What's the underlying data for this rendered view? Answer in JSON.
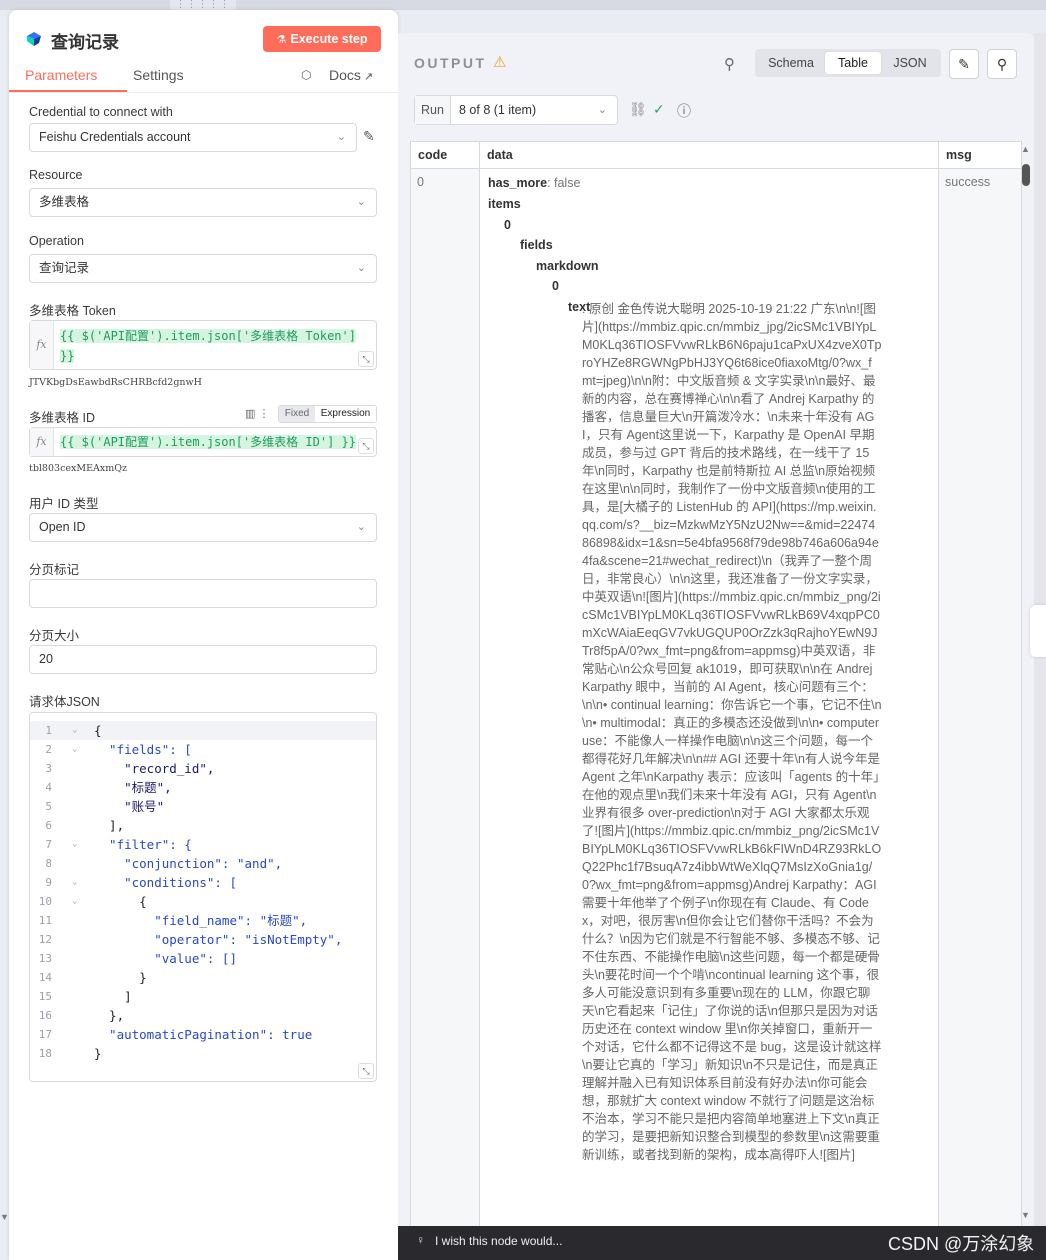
{
  "node": {
    "title": "查询记录",
    "execute_label": "Execute step",
    "tabs": [
      "Parameters",
      "Settings"
    ],
    "docs_label": "Docs"
  },
  "params": {
    "credential": {
      "label": "Credential to connect with",
      "value": "Feishu Credentials account"
    },
    "resource": {
      "label": "Resource",
      "value": "多维表格"
    },
    "operation": {
      "label": "Operation",
      "value": "查询记录"
    },
    "token": {
      "label": "多维表格 Token",
      "expression": "{{ $('API配置').item.json['多维表格 Token'] }}",
      "result": "JTVKbgDsEawbdRsCHRBcfd2gnwH"
    },
    "table_id": {
      "label": "多维表格 ID",
      "toggle_fixed": "Fixed",
      "toggle_expression": "Expression",
      "expression": "{{ $('API配置').item.json['多维表格 ID'] }}",
      "result": "tbl803cexMEAxmQz"
    },
    "user_id_type": {
      "label": "用户 ID 类型",
      "value": "Open ID"
    },
    "page_token": {
      "label": "分页标记",
      "value": ""
    },
    "page_size": {
      "label": "分页大小",
      "value": "20"
    },
    "body_json": {
      "label": "请求体JSON",
      "lines": [
        "{",
        "  \"fields\": [",
        "    \"record_id\",",
        "    \"标题\",",
        "    \"账号\"",
        "  ],",
        "  \"filter\": {",
        "    \"conjunction\": \"and\",",
        "    \"conditions\": [",
        "      {",
        "        \"field_name\": \"标题\",",
        "        \"operator\": \"isNotEmpty\",",
        "        \"value\": []",
        "      }",
        "    ]",
        "  },",
        "  \"automaticPagination\": true",
        "}"
      ]
    }
  },
  "output": {
    "title": "OUTPUT",
    "views": [
      "Schema",
      "Table",
      "JSON"
    ],
    "active_view": "Table",
    "run_label": "Run",
    "run_value": "8 of 8 (1 item)",
    "columns": [
      "code",
      "data",
      "msg"
    ],
    "row": {
      "code": "0",
      "msg": "success",
      "has_more_key": "has_more",
      "has_more_value": ": false",
      "items_key": "items",
      "index0": "0",
      "fields_key": "fields",
      "markdown_key": "markdown",
      "index0b": "0",
      "text_key": "text",
      "text_value": ": 原创 金色传说大聪明 2025-10-19 21:22 广东\\n\\n![图片](https://mmbiz.qpic.cn/mmbiz_jpg/2icSMc1VBIYpLM0KLq36TIOSFVvwRLkB6N6paju1caPxUX4zveX0TproYHZe8RGWNgPbHJ3YQ6t68ice0fiaxoMtg/0?wx_fmt=jpeg)\\n\\n附：中文版音频 & 文字实录\\n\\n最好、最新的内容，总在赛博禅心\\n\\n看了 Andrej Karpathy 的播客，信息量巨大\\n开篇泼冷水：\\n未来十年没有 AGI，只有 Agent这里说一下，Karpathy 是 OpenAI 早期成员，参与过 GPT 背后的技术路线，在一线干了 15 年\\n同时，Karpathy 也是前特斯拉 AI 总监\\n原始视频在这里\\n\\n同时，我制作了一份中文版音频\\n使用的工具，是[大橘子的 ListenHub 的 API](https://mp.weixin.qq.com/s?__biz=MzkwMzY5NzU2Nw==&mid=2247486898&idx=1&sn=5e4bfa9568f79de98b746a606a94e4fa&scene=21#wechat_redirect)\\n（我弄了一整个周日，非常良心）\\n\\n这里，我还准备了一份文字实录，中英双语\\n![图片](https://mmbiz.qpic.cn/mmbiz_png/2icSMc1VBIYpLM0KLq36TIOSFVvwRLkB69V4xqpPC0mXcWAiaEeqGV7vkUGQUP0OrZzk3qRajhoYEwN9JTr8f5pA/0?wx_fmt=png&from=appmsg)中英双语，非常贴心\\n公众号回复 ak1019，即可获取\\n\\n在 Andrej Karpathy 眼中，当前的 AI Agent，核心问题有三个：\\n\\n• continual learning：你告诉它一个事，它记不住\\n\\n• multimodal：真正的多模态还没做到\\n\\n• computer use：不能像人一样操作电脑\\n\\n这三个问题，每一个都得花好几年解决\\n\\n## AGI 还要十年\\n有人说今年是 Agent 之年\\nKarpathy 表示：应该叫「agents 的十年」在他的观点里\\n我们未来十年没有 AGI，只有 Agent\\n业界有很多 over-prediction\\n对于 AGI 大家都太乐观了![图片](https://mmbiz.qpic.cn/mmbiz_png/2icSMc1VBIYpLM0KLq36TIOSFVvwRLkB6kFIWnD4RZ93RkLOQ22Phc1f7BsuqA7z4ibbWtWeXlqQ7MsIzXoGnia1g/0?wx_fmt=png&from=appmsg)Andrej Karpathy：AGI 需要十年他举了个例子\\n你现在有 Claude、有 Codex，对吧，很厉害\\n但你会让它们替你干活吗？不会为什么？\\n因为它们就是不行智能不够、多模态不够、记不住东西、不能操作电脑\\n这些问题，每一个都是硬骨头\\n要花时间一个个啃\\ncontinual learning 这个事，很多人可能没意识到有多重要\\n现在的 LLM，你跟它聊天\\n它看起来「记住」了你说的话\\n但那只是因为对话历史还在 context window 里\\n你关掉窗口，重新开一个对话，它什么都不记得这不是 bug，这是设计就这样\\n要让它真的「学习」新知识\\n不只是记住，而是真正理解并融入已有知识体系目前没有好办法\\n你可能会想，那就扩大 context window 不就行了问题是这治标不治本，学习不能只是把内容简单地塞进上下文\\n真正的学习，是要把新知识整合到模型的参数里\\n这需要重新训练，或者找到新的架构，成本高得吓人![图片]"
    }
  },
  "footer": {
    "wish_text": "I wish this node would...",
    "watermark": "CSDN @万涂幻象"
  },
  "colors": {
    "accent": "#ff6d5a",
    "expression_green": "#1f9c5a",
    "success_green": "#2aa65c",
    "warning": "#f0a020"
  },
  "icons": [
    "feishu-logo-icon",
    "flask-icon",
    "cube-icon",
    "external-link-icon",
    "chevron-down-icon",
    "pencil-icon",
    "fx-icon",
    "resize-icon",
    "panel-icon",
    "kebab-icon",
    "warning-icon",
    "search-icon",
    "edit-icon",
    "pin-icon",
    "link-icon",
    "check-circle-icon",
    "info-icon",
    "bulb-icon"
  ]
}
